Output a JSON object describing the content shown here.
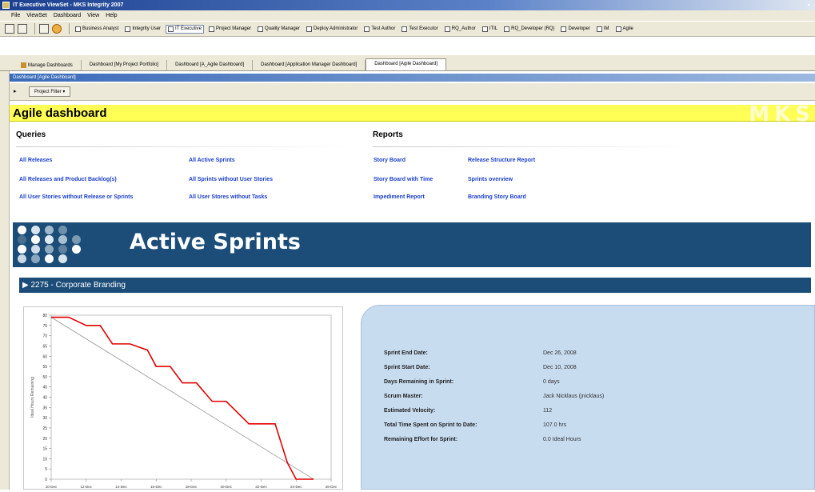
{
  "window": {
    "title": "IT Executive ViewSet - MKS Integrity 2007"
  },
  "menu": [
    "File",
    "ViewSet",
    "Dashboard",
    "View",
    "Help"
  ],
  "toolbar": {
    "buttons": [
      "Business Analyst",
      "Integrity User",
      "IT Executive",
      "Project Manager",
      "Quality Manager",
      "Deploy Administrator",
      "Test Author",
      "Test Executor",
      "RQ_Author",
      "ITIL",
      "RQ_Developer (RQ)",
      "Developer",
      "IM",
      "Agile"
    ],
    "active_index": 2
  },
  "tabs": [
    "Manage Dashboards",
    "Dashboard [My Project Portfolio]",
    "Dashboard [A_Agile Dashboard]",
    "Dashboard [Application Manager Dashboard]",
    "Dashboard [Agile Dashboard]"
  ],
  "active_tab": 4,
  "panel": {
    "title": "Dashboard [Agile Dashboard]"
  },
  "filter": {
    "label": "Project Filter ▾"
  },
  "dashboard": {
    "title": "Agile dashboard",
    "logo": "MKS",
    "queries": {
      "heading": "Queries",
      "col1": [
        "All Releases",
        "All Releases and Product Backlog(s)",
        "All User Stories without Release or Sprints"
      ],
      "col2": [
        "All Active Sprints",
        "All Sprints without User Stories",
        "All User Stores without Tasks"
      ]
    },
    "reports": {
      "heading": "Reports",
      "col1": [
        "Story Board",
        "Story Board with Time",
        "Impediment Report"
      ],
      "col2": [
        "Release Structure Report",
        "Sprints overview",
        "Branding Story Board"
      ]
    },
    "banner_title": "Active Sprints",
    "sprint_title": "2275 - Corporate Branding"
  },
  "sprint_info": [
    {
      "label": "Sprint End Date:",
      "value": "Dec 26, 2008"
    },
    {
      "label": "Sprint Start Date:",
      "value": "Dec 10, 2008"
    },
    {
      "label": "Days Remaining in Sprint:",
      "value": "0 days"
    },
    {
      "label": "Scrum Master:",
      "value": "Jack Nicklaus (jnicklaus)"
    },
    {
      "label": "Estimated Velocity:",
      "value": "112"
    },
    {
      "label": "Total Time Spent on Sprint to Date:",
      "value": "107.0 hrs"
    },
    {
      "label": "Remaining Effort for Sprint:",
      "value": "0.0 Ideal Hours"
    }
  ],
  "colors": {
    "banner": "#1c4d78",
    "title_bar": "#ffff55",
    "burndown": "#e00000",
    "ideal": "#a0a0a0"
  },
  "chart_data": {
    "type": "line",
    "ylabel": "Ideal Hours Remaining",
    "ylim": [
      0,
      80
    ],
    "yticks": [
      0,
      5,
      10,
      15,
      20,
      25,
      30,
      35,
      40,
      45,
      50,
      55,
      60,
      65,
      70,
      75,
      80
    ],
    "xticks": [
      "10-Dec",
      "12-Dec",
      "14-Dec",
      "16-Dec",
      "18-Dec",
      "20-Dec",
      "22-Dec",
      "24-Dec",
      "26-Dec"
    ],
    "xlim": [
      0,
      16
    ],
    "series": [
      {
        "name": "",
        "color": "#e00000",
        "x": [
          0,
          1,
          2,
          2.8,
          3.5,
          4.5,
          5.5,
          6,
          6.8,
          7.5,
          8.3,
          9.2,
          10,
          11.3,
          12.3,
          12.8,
          13.5,
          14,
          15
        ],
        "y": [
          79,
          79,
          75,
          75,
          66,
          66,
          63,
          55,
          55,
          47,
          47,
          38,
          38,
          27,
          27,
          27,
          8,
          0,
          0
        ]
      },
      {
        "name": "",
        "color": "#a0a0a0",
        "x": [
          0,
          15
        ],
        "y": [
          79,
          0
        ]
      }
    ],
    "grid": false
  }
}
